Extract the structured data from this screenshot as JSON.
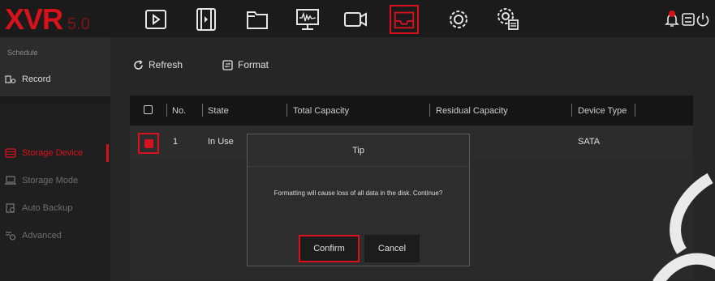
{
  "logo": {
    "brand": "XVR",
    "version": "5.0"
  },
  "sidebar": {
    "header": "Schedule",
    "items": [
      {
        "label": "Record"
      },
      {
        "label": "Storage Device"
      },
      {
        "label": "Storage Mode"
      },
      {
        "label": "Auto Backup"
      },
      {
        "label": "Advanced"
      }
    ]
  },
  "toolbar": {
    "refresh_label": "Refresh",
    "format_label": "Format"
  },
  "table": {
    "headers": [
      "No.",
      "State",
      "Total Capacity",
      "Residual Capacity",
      "Device Type"
    ],
    "rows": [
      {
        "no": "1",
        "state": "In Use",
        "total": "",
        "residual": "",
        "type": "SATA"
      }
    ]
  },
  "dialog": {
    "title": "Tip",
    "message": "Formatting will cause loss of all data in the disk. Continue?",
    "confirm_label": "Confirm",
    "cancel_label": "Cancel"
  },
  "nav_icons": [
    "playback-icon",
    "video-clip-icon",
    "folder-icon",
    "monitor-icon",
    "camera-icon",
    "storage-icon",
    "settings-gear-icon",
    "system-settings-icon"
  ],
  "colors": {
    "accent": "#d8121d",
    "background": "#1a1a1a",
    "panel": "#262626"
  }
}
